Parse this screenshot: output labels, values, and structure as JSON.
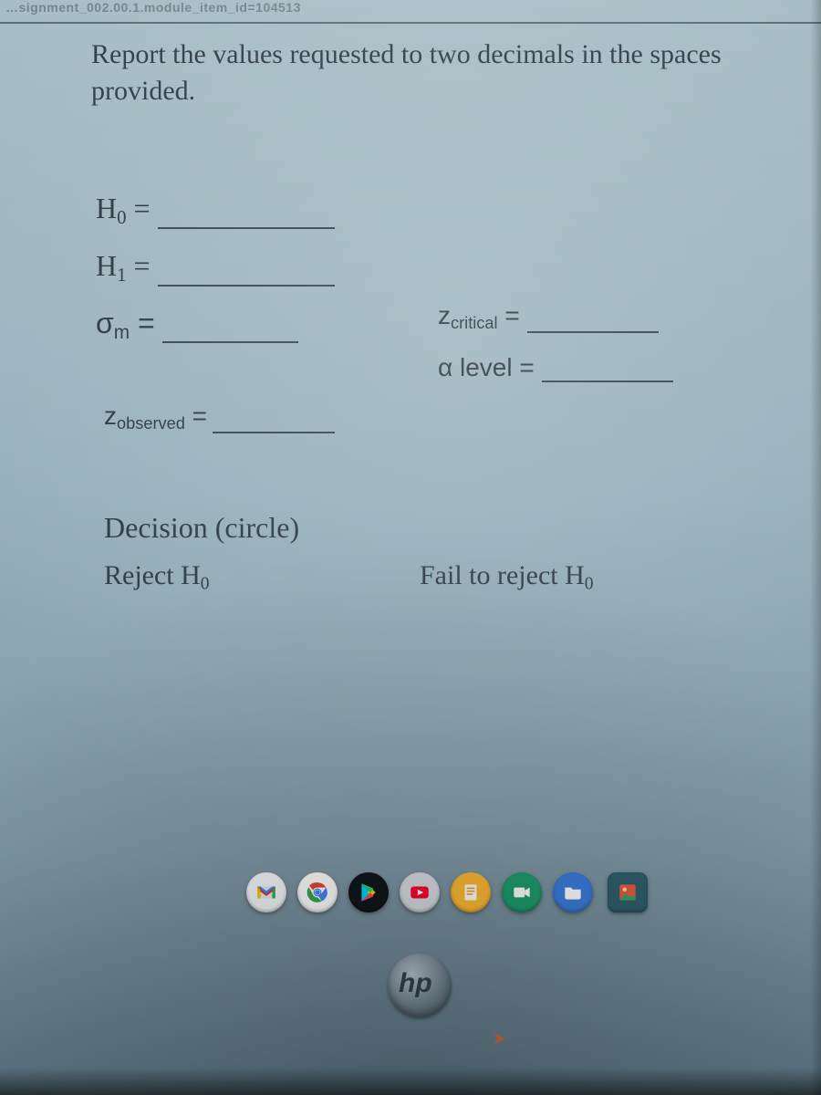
{
  "cropped_header": "…signment_002.00.1.module_item_id=104513",
  "instruction": "Report the values requested to two decimals in the spaces provided.",
  "fields": {
    "h0_label_main": "H",
    "h0_label_sub": "0",
    "h0_eq": " =",
    "h1_label_main": "H",
    "h1_label_sub": "1",
    "h1_eq": " =",
    "sigma_label_main": "σ",
    "sigma_label_sub": "m",
    "sigma_eq": " =",
    "zcrit_label_main": "z",
    "zcrit_label_sub": "critical",
    "zcrit_eq": " =",
    "alpha_label": "α level =",
    "zobs_label_main": "z",
    "zobs_label_sub": "observed",
    "zobs_eq": " ="
  },
  "decision": {
    "title": "Decision (circle)",
    "opt1_pre": "Reject H",
    "opt1_sub": "0",
    "opt2_pre": "Fail to reject H",
    "opt2_sub": "0"
  },
  "shelf": {
    "gmail": "gmail-icon",
    "chrome": "chrome-icon",
    "play": "google-play-icon",
    "youtube": "youtube-icon",
    "docs": "docs-icon",
    "meet": "camera-icon",
    "files": "files-icon",
    "photos": "photos-icon"
  },
  "logo": "hp"
}
